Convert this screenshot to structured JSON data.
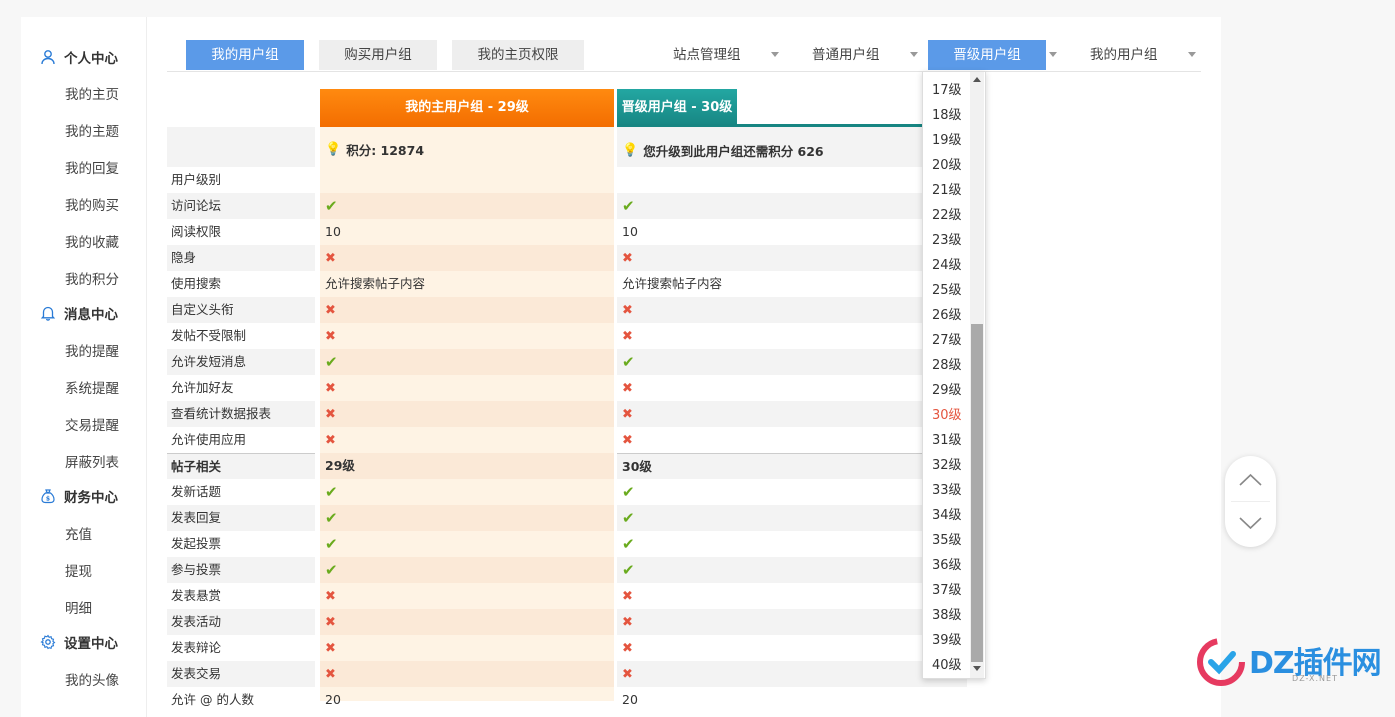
{
  "sidebar": {
    "sections": [
      {
        "title": "个人中心",
        "icon": "user-icon",
        "items": [
          "我的主页",
          "我的主题",
          "我的回复",
          "我的购买",
          "我的收藏",
          "我的积分"
        ]
      },
      {
        "title": "消息中心",
        "icon": "bell-icon",
        "items": [
          "我的提醒",
          "系统提醒",
          "交易提醒",
          "屏蔽列表"
        ]
      },
      {
        "title": "财务中心",
        "icon": "money-bag-icon",
        "items": [
          "充值",
          "提现",
          "明细"
        ]
      },
      {
        "title": "设置中心",
        "icon": "gear-icon",
        "items": [
          "我的头像"
        ]
      }
    ]
  },
  "tabs": {
    "left": [
      "我的用户组",
      "购买用户组",
      "我的主页权限"
    ],
    "right": [
      "站点管理组",
      "普通用户组",
      "晋级用户组",
      "我的用户组"
    ],
    "active_left": "我的用户组",
    "active_right": "晋级用户组"
  },
  "groups": {
    "my_group_title": "我的主用户组 - 29级",
    "next_group_title": "晋级用户组 - 30级",
    "my_points": "积分: 12874",
    "need_points": "您升级到此用户组还需积分 626"
  },
  "table": {
    "rows": [
      {
        "label": "用户级别",
        "v1": "",
        "v2": ""
      },
      {
        "label": "访问论坛",
        "v1": "ok",
        "v2": "ok"
      },
      {
        "label": "阅读权限",
        "v1": "10",
        "v2": "10"
      },
      {
        "label": "隐身",
        "v1": "no",
        "v2": "no"
      },
      {
        "label": "使用搜索",
        "v1": "允许搜索帖子内容",
        "v2": "允许搜索帖子内容"
      },
      {
        "label": "自定义头衔",
        "v1": "no",
        "v2": "no"
      },
      {
        "label": "发帖不受限制",
        "v1": "no",
        "v2": "no"
      },
      {
        "label": "允许发短消息",
        "v1": "ok",
        "v2": "ok"
      },
      {
        "label": "允许加好友",
        "v1": "no",
        "v2": "no"
      },
      {
        "label": "查看统计数据报表",
        "v1": "no",
        "v2": "no"
      },
      {
        "label": "允许使用应用",
        "v1": "no",
        "v2": "no"
      },
      {
        "label": "帖子相关",
        "v1": "29级",
        "v2": "30级",
        "section": true
      },
      {
        "label": "发新话题",
        "v1": "ok",
        "v2": "ok"
      },
      {
        "label": "发表回复",
        "v1": "ok",
        "v2": "ok"
      },
      {
        "label": "发起投票",
        "v1": "ok",
        "v2": "ok"
      },
      {
        "label": "参与投票",
        "v1": "ok",
        "v2": "ok"
      },
      {
        "label": "发表悬赏",
        "v1": "no",
        "v2": "no"
      },
      {
        "label": "发表活动",
        "v1": "no",
        "v2": "no"
      },
      {
        "label": "发表辩论",
        "v1": "no",
        "v2": "no"
      },
      {
        "label": "发表交易",
        "v1": "no",
        "v2": "no"
      },
      {
        "label": "允许 @ 的人数",
        "v1": "20",
        "v2": "20"
      }
    ]
  },
  "level_dropdown": {
    "options": [
      "17级",
      "18级",
      "19级",
      "20级",
      "21级",
      "22级",
      "23级",
      "24级",
      "25级",
      "26级",
      "27级",
      "28级",
      "29级",
      "30级",
      "31级",
      "32级",
      "33级",
      "34级",
      "35级",
      "36级",
      "37级",
      "38级",
      "39级",
      "40级"
    ],
    "selected": "30级"
  },
  "watermark": {
    "brand": "DZ插件网",
    "url": "DZ-X.NET"
  },
  "colors": {
    "accent": "#5b9ae8",
    "orange": "#ff7a00",
    "teal": "#1b9591",
    "ok": "#6aab1e",
    "no": "#e4553f"
  }
}
